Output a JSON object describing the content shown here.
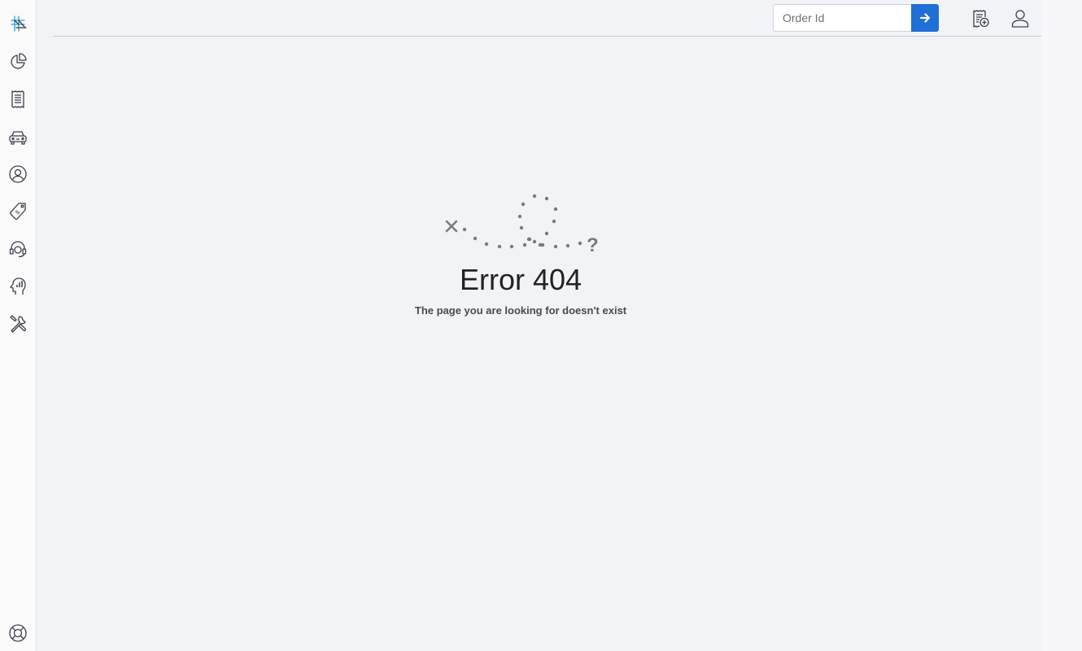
{
  "header": {
    "order_search": {
      "placeholder": "Order Id",
      "value": ""
    },
    "submit_icon": "arrow-right-icon",
    "actions": [
      {
        "icon": "new-order-icon"
      },
      {
        "icon": "user-account-icon"
      }
    ]
  },
  "sidebar": {
    "logo_icon": "app-logo-icon",
    "items": [
      {
        "icon": "pie-chart-icon"
      },
      {
        "icon": "receipt-icon"
      },
      {
        "icon": "car-icon"
      },
      {
        "icon": "user-circle-icon"
      },
      {
        "icon": "price-tag-icon"
      },
      {
        "icon": "headset-support-icon"
      },
      {
        "icon": "analytics-head-icon"
      },
      {
        "icon": "tools-icon"
      }
    ],
    "footer_icon": "lifebuoy-help-icon"
  },
  "error": {
    "illustration": "lost-path-icon",
    "title": "Error 404",
    "message": "The page you are looking for doesn't exist"
  },
  "colors": {
    "accent": "#1f6fd6",
    "background": "#f2f3f7",
    "sidebar_bg": "#fafafa",
    "icon_stroke": "#3a3f4a",
    "illustration_gray": "#7a7a7a"
  }
}
